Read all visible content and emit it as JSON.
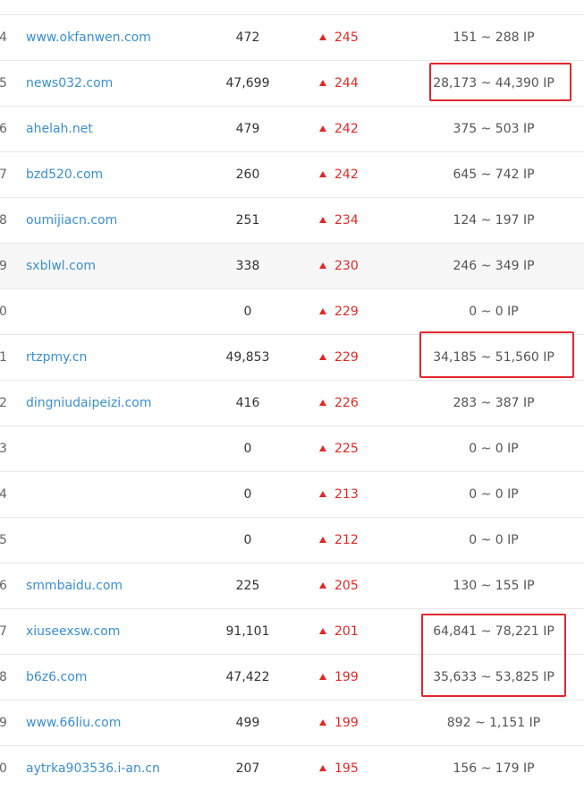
{
  "colors": {
    "link": "#3a8fd1",
    "up": "#e02828",
    "highlight_box": "#e0282e"
  },
  "rows": [
    {
      "rank": "4",
      "domain": "www.okfanwen.com",
      "pv": "472",
      "change": "245",
      "ip_range": "151 ~ 288 IP",
      "highlighted": false
    },
    {
      "rank": "5",
      "domain": "news032.com",
      "pv": "47,699",
      "change": "244",
      "ip_range": "28,173 ~ 44,390 IP",
      "highlighted": true
    },
    {
      "rank": "6",
      "domain": "ahelah.net",
      "pv": "479",
      "change": "242",
      "ip_range": "375 ~ 503 IP",
      "highlighted": false
    },
    {
      "rank": "7",
      "domain": "bzd520.com",
      "pv": "260",
      "change": "242",
      "ip_range": "645 ~ 742 IP",
      "highlighted": false
    },
    {
      "rank": "8",
      "domain": "oumijiacn.com",
      "pv": "251",
      "change": "234",
      "ip_range": "124 ~ 197 IP",
      "highlighted": false
    },
    {
      "rank": "9",
      "domain": "sxblwl.com",
      "pv": "338",
      "change": "230",
      "ip_range": "246 ~ 349 IP",
      "highlighted": false
    },
    {
      "rank": "0",
      "domain": "",
      "pv": "0",
      "change": "229",
      "ip_range": "0 ~ 0 IP",
      "highlighted": false
    },
    {
      "rank": "1",
      "domain": "rtzpmy.cn",
      "pv": "49,853",
      "change": "229",
      "ip_range": "34,185 ~ 51,560 IP",
      "highlighted": true
    },
    {
      "rank": "2",
      "domain": "dingniudaipeizi.com",
      "pv": "416",
      "change": "226",
      "ip_range": "283 ~ 387 IP",
      "highlighted": false
    },
    {
      "rank": "3",
      "domain": "",
      "pv": "0",
      "change": "225",
      "ip_range": "0 ~ 0 IP",
      "highlighted": false
    },
    {
      "rank": "4",
      "domain": "",
      "pv": "0",
      "change": "213",
      "ip_range": "0 ~ 0 IP",
      "highlighted": false
    },
    {
      "rank": "5",
      "domain": "",
      "pv": "0",
      "change": "212",
      "ip_range": "0 ~ 0 IP",
      "highlighted": false
    },
    {
      "rank": "6",
      "domain": "smmbaidu.com",
      "pv": "225",
      "change": "205",
      "ip_range": "130 ~ 155 IP",
      "highlighted": false
    },
    {
      "rank": "7",
      "domain": "xiuseexsw.com",
      "pv": "91,101",
      "change": "201",
      "ip_range": "64,841 ~ 78,221 IP",
      "highlighted": true
    },
    {
      "rank": "8",
      "domain": "b6z6.com",
      "pv": "47,422",
      "change": "199",
      "ip_range": "35,633 ~ 53,825 IP",
      "highlighted": true
    },
    {
      "rank": "9",
      "domain": "www.66liu.com",
      "pv": "499",
      "change": "199",
      "ip_range": "892 ~ 1,151 IP",
      "highlighted": false
    },
    {
      "rank": "0",
      "domain": "aytrka903536.i-an.cn",
      "pv": "207",
      "change": "195",
      "ip_range": "156 ~ 179 IP",
      "highlighted": false
    }
  ]
}
